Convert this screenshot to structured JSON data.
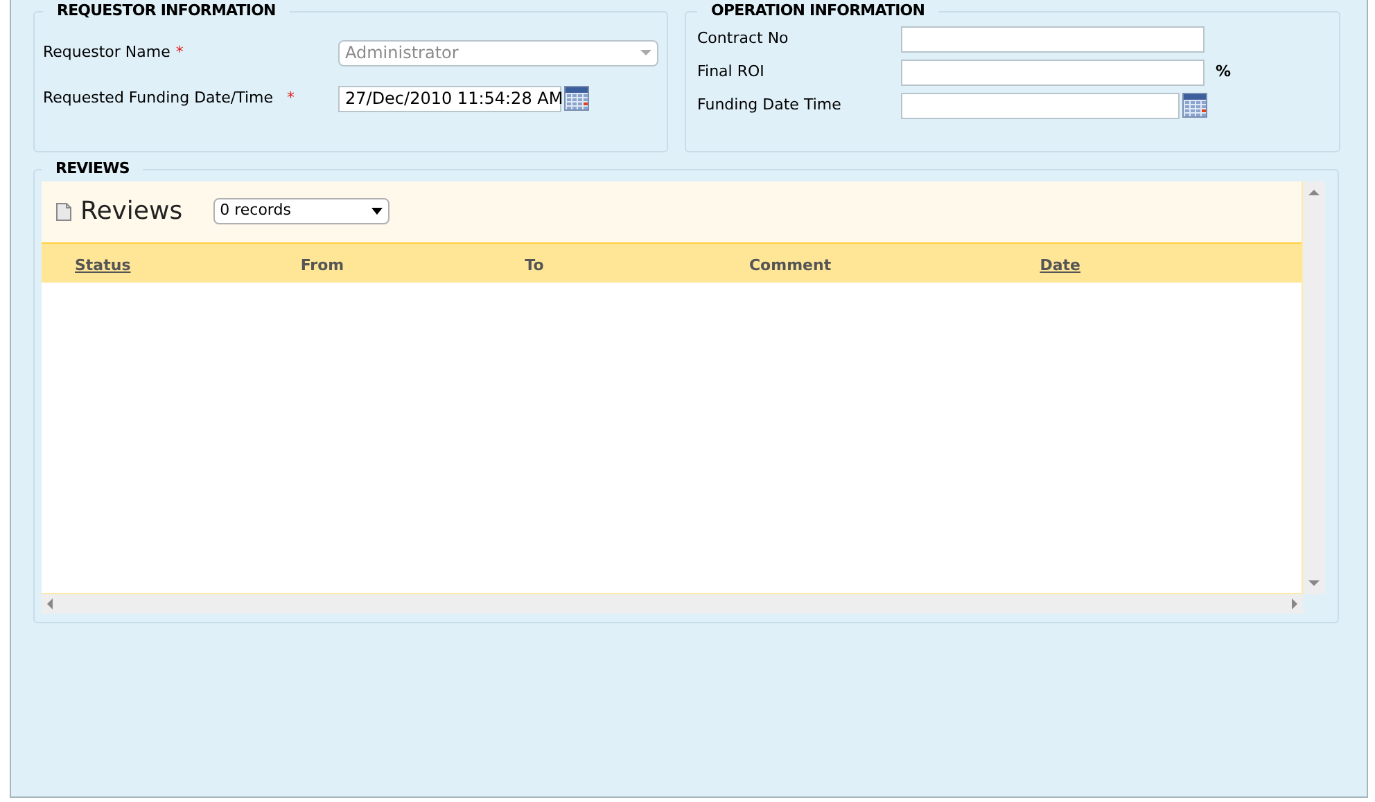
{
  "requestor": {
    "title": "REQUESTOR INFORMATION",
    "fields": [
      {
        "label": "Requestor Name",
        "required_mark": "*",
        "kind": "select",
        "value": "Administrator",
        "disabled": true
      },
      {
        "label": "Requested Funding Date/Time",
        "required_mark": "*",
        "kind": "date",
        "value": "27/Dec/2010 11:54:28 AM",
        "disabled": false
      }
    ]
  },
  "operation": {
    "title": "OPERATION INFORMATION",
    "fields": [
      {
        "label": "Contract No",
        "kind": "text"
      },
      {
        "label": "Final ROI",
        "kind": "text",
        "suffix": "%"
      },
      {
        "label": "Funding Date Time",
        "kind": "date"
      }
    ]
  },
  "reviews": {
    "title": "REVIEWS",
    "grid_title": "Reviews",
    "records": "0 records",
    "columns": [
      {
        "label": "Status",
        "sortable": true
      },
      {
        "label": "From",
        "sortable": false
      },
      {
        "label": "To",
        "sortable": false
      },
      {
        "label": "Comment",
        "sortable": false
      },
      {
        "label": "Date",
        "sortable": true
      }
    ]
  }
}
